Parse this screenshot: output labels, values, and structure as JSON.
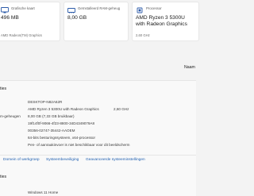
{
  "cards": [
    {
      "label": "Grafische kaart",
      "value": "496 MB",
      "sub": "AMD Radeon(TM) Graphics",
      "icon": "display-icon"
    },
    {
      "label": "Geïnstalleerd RAM-geheug",
      "value": "8,00 GB",
      "sub": "",
      "icon": "memory-icon"
    },
    {
      "label": "Processor",
      "value_line1": "AMD Ryzen 3 5300U",
      "value_line2": "with Radeon Graphics",
      "sub": "2,60 GHz",
      "icon": "processor-icon"
    }
  ],
  "right_link_partial": "Naam",
  "specs": {
    "section_title": "ties",
    "rows": [
      {
        "label": "",
        "value": "DESKTOP-N82A62R",
        "extra": ""
      },
      {
        "label": "",
        "value": "AMD Ryzen 3 5300U with Radeon Graphics",
        "extra": "2,60 GHz"
      },
      {
        "label": "m-geheugen",
        "value": "8,00 GB (7,33 GB bruikbaar)",
        "extra": ""
      },
      {
        "label": "",
        "value": "19f14f0f-9066-4f23-8800-34D4349079A8",
        "extra": ""
      },
      {
        "label": "",
        "value": "00356-02747-35442-AAOEM",
        "extra": ""
      },
      {
        "label": "",
        "value": "64-bits besturingssysteem, x64-processor",
        "extra": ""
      },
      {
        "label": "",
        "value": "Pen- of aanraakinvoer is niet beschikbaar voor dit beeldscherm",
        "extra": ""
      }
    ]
  },
  "links": [
    "Domein of werkgroep",
    "Systeembeveiliging",
    "Geavanceerde systeeminstellingen"
  ],
  "windows": {
    "section_title": "ties",
    "value": "Windows 11 Home"
  },
  "colors": {
    "link": "#1f5fb0",
    "background": "#f3f3f3",
    "card": "#ffffff"
  }
}
